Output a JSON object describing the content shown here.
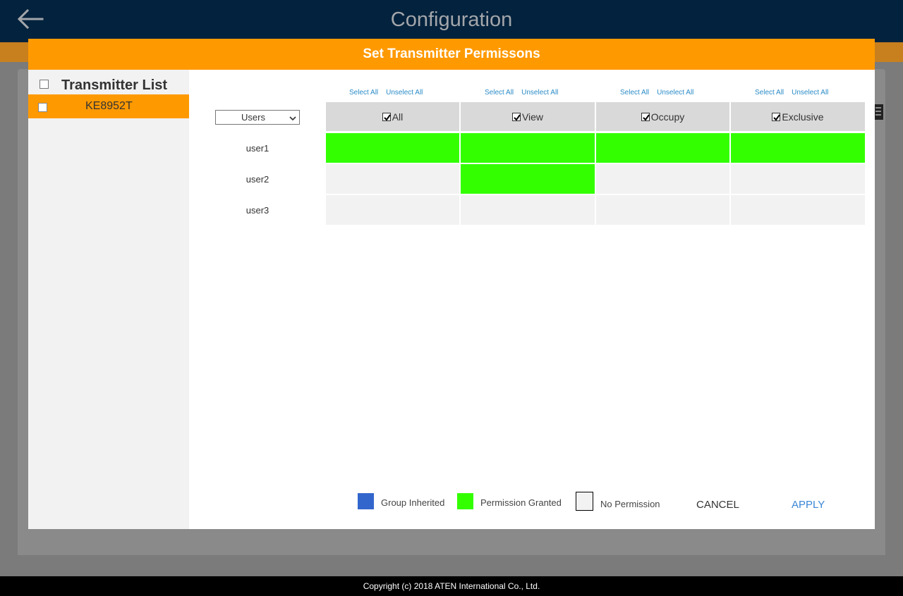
{
  "app": {
    "title": "Configuration",
    "footer": "Copyright (c) 2018 ATEN International Co., Ltd."
  },
  "modal": {
    "title": "Set Transmitter Permissons",
    "transmitter_list": {
      "title": "Transmitter List",
      "items": [
        {
          "name": "KE8952T",
          "selected": true
        }
      ]
    },
    "filter": {
      "selected": "Users"
    },
    "select_all_label": "Select All",
    "unselect_all_label": "Unselect All",
    "columns": [
      {
        "label": "All",
        "checked": true
      },
      {
        "label": "View",
        "checked": true
      },
      {
        "label": "Occupy",
        "checked": true
      },
      {
        "label": "Exclusive",
        "checked": true
      }
    ],
    "rows": [
      {
        "user": "user1",
        "permissions": [
          "granted",
          "granted",
          "granted",
          "granted"
        ]
      },
      {
        "user": "user2",
        "permissions": [
          "none",
          "granted",
          "none",
          "none"
        ]
      },
      {
        "user": "user3",
        "permissions": [
          "none",
          "none",
          "none",
          "none"
        ]
      }
    ],
    "legend": [
      {
        "label": "Group Inherited",
        "color": "#3366cc"
      },
      {
        "label": "Permission Granted",
        "color": "#33ff00"
      },
      {
        "label": "No Permission",
        "color": "#f2f2f2"
      }
    ],
    "buttons": {
      "cancel": "CANCEL",
      "apply": "APPLY"
    },
    "colors": {
      "header": "#ff9900",
      "granted": "#33ff00",
      "inherited": "#3366cc",
      "link": "#2a8bc7",
      "apply": "#3a86d6"
    }
  }
}
